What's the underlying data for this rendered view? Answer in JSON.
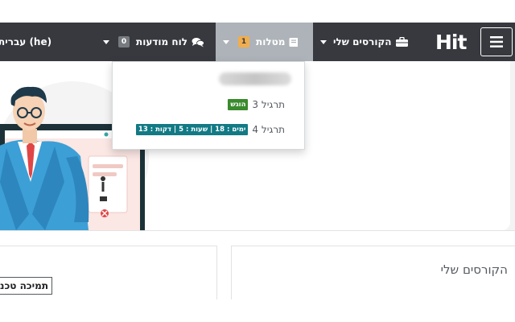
{
  "navbar": {
    "language_label": "עברית (he)",
    "notifications_label": "לוח מודעות",
    "notifications_count": "0",
    "tasks_label": "מטלות",
    "tasks_count": "1",
    "my_courses_label": "הקורסים שלי",
    "logo_text": "Hit"
  },
  "tasks_dropdown": {
    "items": [
      {
        "title": "תרגיל 3",
        "status": "הוגש",
        "status_color": "#3a8a2e"
      },
      {
        "title": "תרגיל 4",
        "status": "ימים : 18 | שעות : 5 | דקות : 13",
        "status_color": "#127a85"
      }
    ]
  },
  "main": {
    "my_courses_title": "הקורסים שלי",
    "support_label": "תמיכה טכנ"
  },
  "colors": {
    "navbar": "#37393f",
    "active_nav": "#adb3b8",
    "badge_yellow": "#f0ad4e"
  }
}
